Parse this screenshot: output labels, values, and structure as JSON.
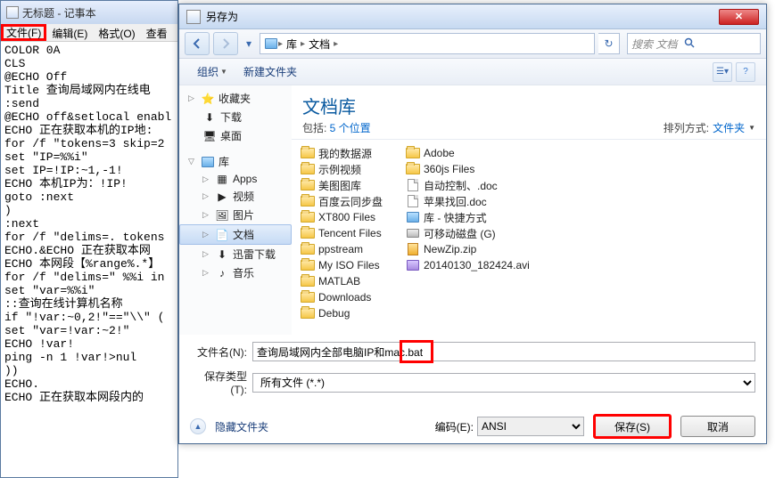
{
  "notepad": {
    "title": "无标题 - 记事本",
    "menu": {
      "file": "文件(F)",
      "edit": "编辑(E)",
      "format": "格式(O)",
      "view": "查看"
    },
    "content": "COLOR 0A\nCLS\n@ECHO Off\nTitle 查询局域网内在线电\n:send\n@ECHO off&setlocal enabl\nECHO 正在获取本机的IP地:\nfor /f \"tokens=3 skip=2\nset \"IP=%%i\"\nset IP=!IP:~1,-1!\nECHO 本机IP为：!IP!\ngoto :next\n)\n:next\nfor /f \"delims=. tokens\nECHO.&ECHO 正在获取本网\nECHO 本网段【%range%.*】\nfor /f \"delims=\" %%i in\nset \"var=%%i\"\n::查询在线计算机名称\nif \"!var:~0,2!\"==\"\\\\\" (\nset \"var=!var:~2!\"\nECHO !var!\nping -n 1 !var!>nul\n))\nECHO.\nECHO 正在获取本网段内的"
  },
  "saveas": {
    "title": "另存为",
    "breadcrumb": {
      "lib": "库",
      "doc": "文档"
    },
    "search_placeholder": "搜索 文档",
    "toolbar": {
      "organize": "组织",
      "newfolder": "新建文件夹"
    },
    "tree": {
      "fav": "收藏夹",
      "downloads": "下载",
      "desktop": "桌面",
      "lib": "库",
      "apps": "Apps",
      "video": "视频",
      "pictures": "图片",
      "docs": "文档",
      "xunlei": "迅雷下载",
      "music": "音乐"
    },
    "main": {
      "title": "文档库",
      "sub_prefix": "包括: ",
      "sub_link": "5 个位置",
      "sort_label": "排列方式:",
      "sort_value": "文件夹"
    },
    "files": {
      "col1": [
        "我的数据源",
        "示例视频",
        "美图图库",
        "百度云同步盘",
        "XT800 Files",
        "Tencent Files",
        "ppstream",
        "My ISO Files",
        "MATLAB"
      ],
      "col2": [
        {
          "name": "Downloads",
          "type": "folder"
        },
        {
          "name": "Debug",
          "type": "folder"
        },
        {
          "name": "Adobe",
          "type": "folder"
        },
        {
          "name": "360js Files",
          "type": "folder"
        },
        {
          "name": "自动控制、.doc",
          "type": "doc"
        },
        {
          "name": "苹果找回.doc",
          "type": "doc"
        },
        {
          "name": "库 - 快捷方式",
          "type": "lib"
        },
        {
          "name": "可移动磁盘 (G)",
          "type": "hd"
        },
        {
          "name": "NewZip.zip",
          "type": "zip"
        }
      ],
      "col3": [
        {
          "name": "20140130_182424.avi",
          "type": "vid"
        }
      ]
    },
    "filename_label": "文件名(N):",
    "filename_value": "查询局域网内全部电脑IP和mac.bat",
    "filetype_label": "保存类型(T):",
    "filetype_value": "所有文件 (*.*)",
    "hide_folders": "隐藏文件夹",
    "encoding_label": "编码(E):",
    "encoding_value": "ANSI",
    "save_btn": "保存(S)",
    "cancel_btn": "取消"
  }
}
